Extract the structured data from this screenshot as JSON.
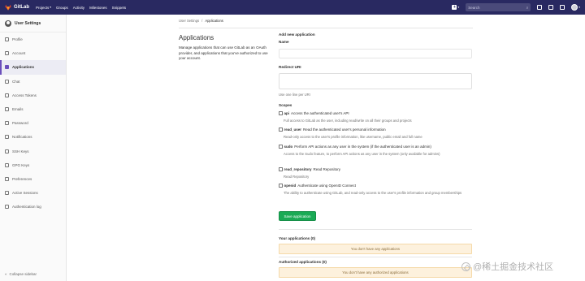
{
  "navbar": {
    "brand": "GitLab",
    "links": [
      "Projects",
      "Groups",
      "Activity",
      "Milestones",
      "Snippets"
    ],
    "search_placeholder": "Search"
  },
  "sidebar": {
    "title": "User Settings",
    "items": [
      {
        "label": "Profile",
        "icon": "user-icon",
        "active": false
      },
      {
        "label": "Account",
        "icon": "gear-icon",
        "active": false
      },
      {
        "label": "Applications",
        "icon": "grid-icon",
        "active": true
      },
      {
        "label": "Chat",
        "icon": "chat-icon",
        "active": false
      },
      {
        "label": "Access Tokens",
        "icon": "key-icon",
        "active": false
      },
      {
        "label": "Emails",
        "icon": "envelope-icon",
        "active": false
      },
      {
        "label": "Password",
        "icon": "lock-icon",
        "active": false
      },
      {
        "label": "Notifications",
        "icon": "bell-icon",
        "active": false
      },
      {
        "label": "SSH Keys",
        "icon": "key-icon",
        "active": false
      },
      {
        "label": "GPG Keys",
        "icon": "key-icon",
        "active": false
      },
      {
        "label": "Preferences",
        "icon": "sliders-icon",
        "active": false
      },
      {
        "label": "Active Sessions",
        "icon": "monitor-icon",
        "active": false
      },
      {
        "label": "Authentication log",
        "icon": "list-icon",
        "active": false
      }
    ],
    "collapse_label": "Collapse sidebar"
  },
  "breadcrumb": {
    "parent": "User Settings",
    "separator": "/",
    "current": "Applications"
  },
  "intro": {
    "title": "Applications",
    "description": "Manage applications that can use GitLab as an OAuth provider, and applications that you've authorized to use your account."
  },
  "form": {
    "heading": "Add new application",
    "name_label": "Name",
    "redirect_label": "Redirect URI",
    "redirect_help": "Use one line per URI",
    "scopes_label": "Scopes",
    "scopes": [
      {
        "name": "api",
        "desc": "Access the authenticated user's API",
        "help": "Full access to GitLab as the user, including read/write on all their groups and projects"
      },
      {
        "name": "read_user",
        "desc": "Read the authenticated user's personal information",
        "help": "Read-only access to the user's profile information, like username, public email and full name"
      },
      {
        "name": "sudo",
        "desc": "Perform API actions as any user in the system (if the authenticated user is an admin)",
        "help": "Access to the Sudo feature, to perform API actions as any user in the system (only available for admins)"
      },
      {
        "name": "read_repository",
        "desc": "Read Repository",
        "help": "Read Repository"
      },
      {
        "name": "openid",
        "desc": "Authenticate using OpenID Connect",
        "help": "The ability to authenticate using GitLab, and read-only access to the user's profile information and group memberships"
      }
    ],
    "save_label": "Save application"
  },
  "your_apps": {
    "title": "Your applications (0)",
    "empty": "You don't have any applications"
  },
  "authorized_apps": {
    "title": "Authorized applications (0)",
    "empty": "You don't have any authorized applications"
  },
  "watermark": "@稀土掘金技术社区"
}
